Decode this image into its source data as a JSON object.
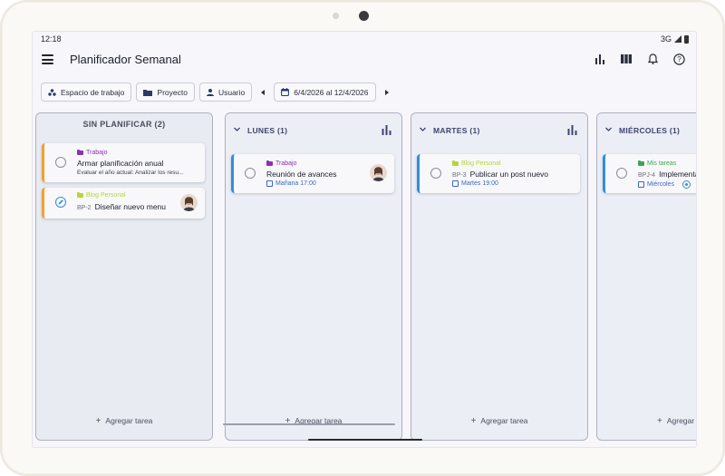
{
  "status_bar": {
    "time": "12:18",
    "network": "3G"
  },
  "app_bar": {
    "title": "Planificador Semanal",
    "actions": [
      "bar-chart-icon",
      "view-columns-icon",
      "bell-icon",
      "help-icon"
    ]
  },
  "filters": {
    "workspace": "Espacio de trabajo",
    "project": "Proyecto",
    "user": "Usuario",
    "date_range": "6/4/2026 al 12/4/2026"
  },
  "colors": {
    "accent_blue": "#2f8ee0",
    "accent_orange": "#f0a22e",
    "category_trabajo": "#8e2fb5",
    "category_blog": "#b7d53b",
    "category_mis_tareas": "#3aa655",
    "date_blue": "#3b66c4"
  },
  "columns": {
    "unplanned": {
      "title": "SIN PLANIFICAR (2)",
      "add_label": "Agregar tarea",
      "cards": [
        {
          "category": "Trabajo",
          "title": "Armar planificación anual",
          "description": "Evaluar el año actual: Analizar los resu..."
        },
        {
          "category": "Blog Personal",
          "code": "BP-2",
          "title": "Diseñar nuevo menu"
        }
      ]
    },
    "monday": {
      "title": "LUNES (1)",
      "add_label": "Agregar tarea",
      "cards": [
        {
          "category": "Trabajo",
          "title": "Reunión de avances",
          "due": "Mañana 17:00"
        }
      ]
    },
    "tuesday": {
      "title": "MARTES (1)",
      "add_label": "Agregar tarea",
      "cards": [
        {
          "category": "Blog Personal",
          "code": "BP-3",
          "title": "Publicar un post nuevo",
          "due": "Martes 19:00"
        }
      ]
    },
    "wednesday": {
      "title": "MIÉRCOLES (1)",
      "add_label": "Agregar",
      "cards": [
        {
          "category": "Mis tareas",
          "code": "BPJ-4",
          "title": "Implementar",
          "due": "Miércoles"
        }
      ]
    }
  }
}
